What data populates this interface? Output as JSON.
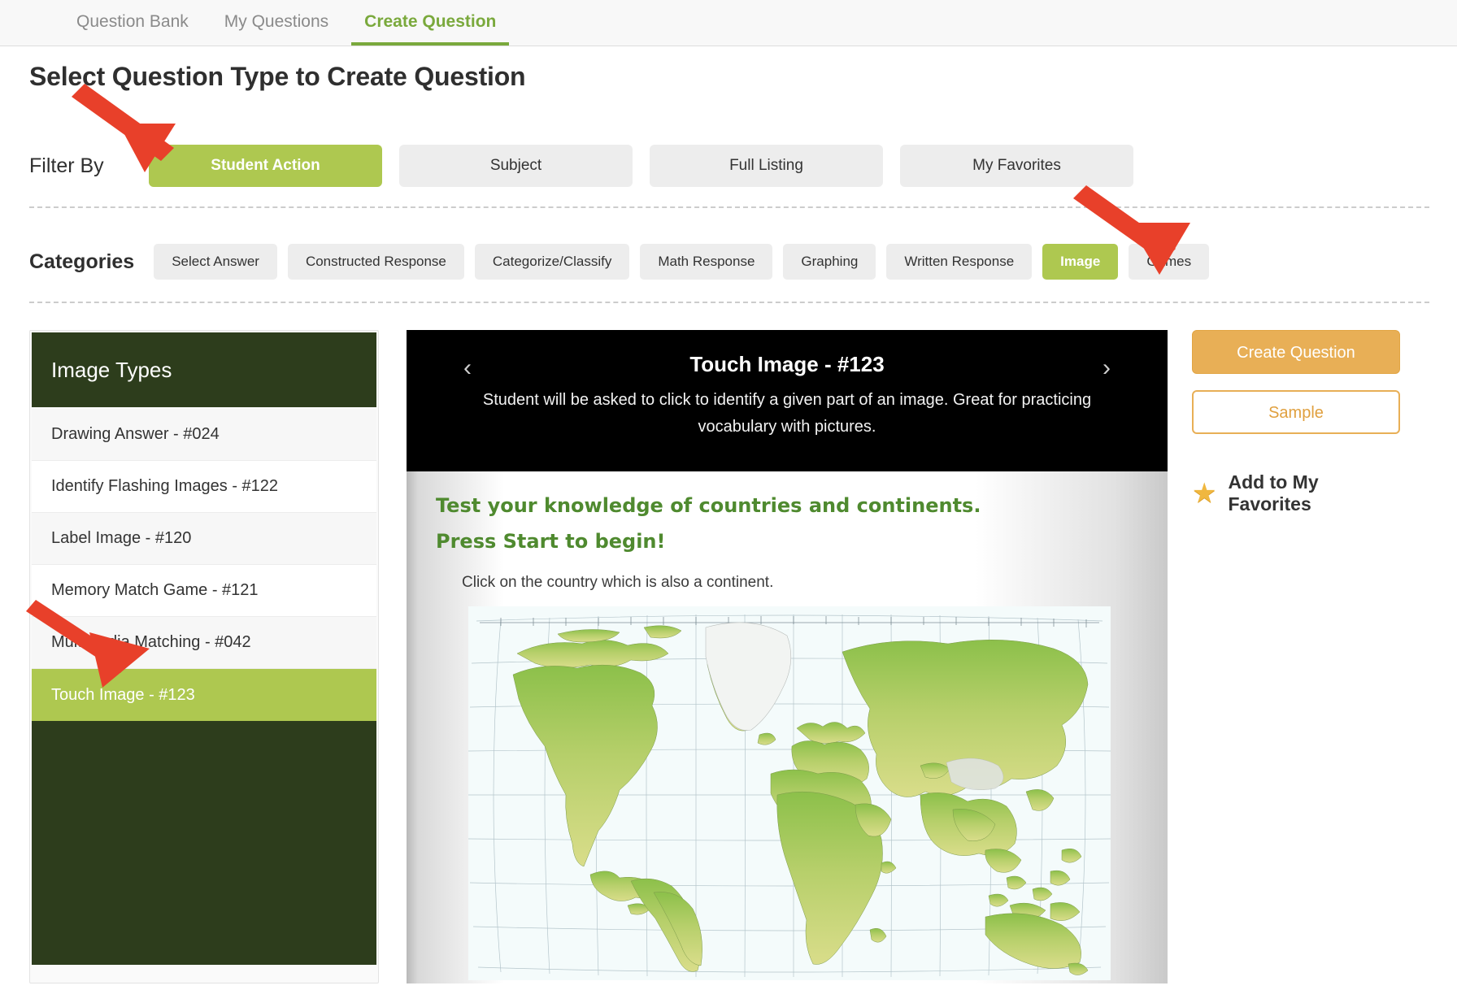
{
  "tabs": [
    {
      "label": "Question Bank",
      "active": false
    },
    {
      "label": "My Questions",
      "active": false
    },
    {
      "label": "Create Question",
      "active": true
    }
  ],
  "page_title": "Select Question Type to Create Question",
  "filter": {
    "label": "Filter By",
    "options": [
      {
        "label": "Student Action",
        "active": true
      },
      {
        "label": "Subject",
        "active": false
      },
      {
        "label": "Full Listing",
        "active": false
      },
      {
        "label": "My Favorites",
        "active": false
      }
    ]
  },
  "categories": {
    "label": "Categories",
    "options": [
      {
        "label": "Select Answer",
        "active": false
      },
      {
        "label": "Constructed Response",
        "active": false
      },
      {
        "label": "Categorize/Classify",
        "active": false
      },
      {
        "label": "Math Response",
        "active": false
      },
      {
        "label": "Graphing",
        "active": false
      },
      {
        "label": "Written Response",
        "active": false
      },
      {
        "label": "Image",
        "active": true
      },
      {
        "label": "Games",
        "active": false
      }
    ]
  },
  "sidebar": {
    "header": "Image Types",
    "items": [
      {
        "label": "Drawing Answer - #024",
        "active": false
      },
      {
        "label": "Identify Flashing Images - #122",
        "active": false
      },
      {
        "label": "Label Image - #120",
        "active": false
      },
      {
        "label": "Memory Match Game - #121",
        "active": false
      },
      {
        "label": "Multimedia Matching - #042",
        "active": false
      },
      {
        "label": "Touch Image - #123",
        "active": true
      }
    ]
  },
  "preview": {
    "prev_icon": "‹",
    "next_icon": "›",
    "title": "Touch Image - #123",
    "description": "Student will be asked to click to identify a given part of an image. Great for practicing vocabulary with pictures.",
    "slide_line1": "Test your knowledge of countries and continents.",
    "slide_line2": "Press Start to begin!",
    "slide_line3": "Click on the country which is also a continent.",
    "image_alt": "world-physical-map"
  },
  "actions": {
    "create_label": "Create Question",
    "sample_label": "Sample",
    "favorite_icon": "★",
    "favorite_label": "Add to My Favorites"
  },
  "colors": {
    "accent_green": "#aec850",
    "tab_green": "#7aa93c",
    "dark_green": "#2d3d1c",
    "orange": "#e8af56",
    "annotation_red": "#e8402a"
  }
}
